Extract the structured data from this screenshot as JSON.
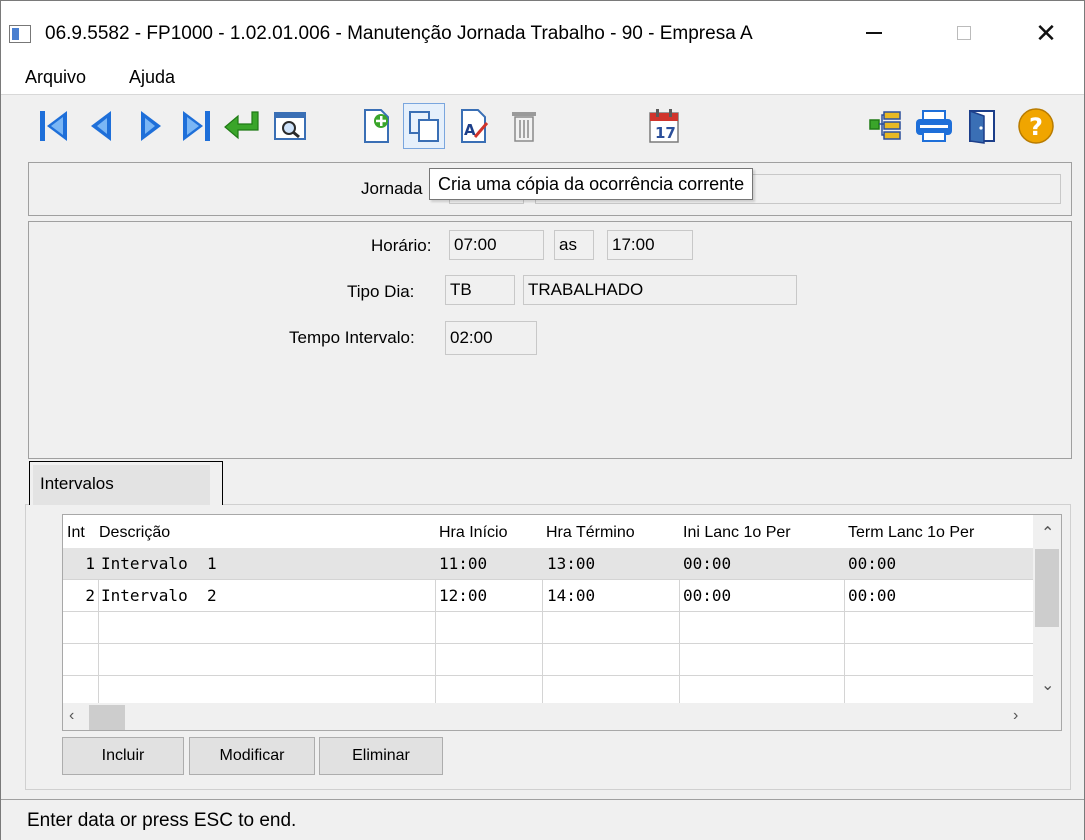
{
  "window": {
    "title": "06.9.5582 - FP1000 - 1.02.01.006 - Manutenção Jornada Trabalho - 90 - Empresa A"
  },
  "menu": {
    "items": [
      "Arquivo",
      "Ajuda"
    ]
  },
  "toolbar": {
    "icons": [
      "first-record-icon",
      "previous-record-icon",
      "next-record-icon",
      "last-record-icon",
      "confirm-enter-icon",
      "search-preview-icon",
      "new-record-icon",
      "copy-record-icon",
      "edit-record-icon",
      "delete-record-icon",
      "calendar-icon",
      "tree-structure-icon",
      "print-icon",
      "exit-door-icon",
      "help-icon"
    ],
    "calendar_day": "17",
    "tooltip": "Cria uma cópia da ocorrência corrente"
  },
  "header": {
    "jornada_label": "Jornada"
  },
  "form": {
    "horario_label": "Horário:",
    "horario_inicio": "07:00",
    "as_label": "as",
    "horario_fim": "17:00",
    "tipo_dia_label": "Tipo Dia:",
    "tipo_dia_codigo": "TB",
    "tipo_dia_descricao": "TRABALHADO",
    "tempo_intervalo_label": "Tempo Intervalo:",
    "tempo_intervalo": "02:00"
  },
  "tabs": {
    "intervalos": "Intervalos"
  },
  "grid": {
    "columns": [
      "Int",
      "Descrição",
      "Hra Início",
      "Hra Término",
      "Ini Lanc 1o Per",
      "Term Lanc 1o Per"
    ],
    "rows": [
      {
        "int": "1",
        "descricao": "Intervalo  1",
        "hra_inicio": "11:00",
        "hra_termino": "13:00",
        "ini_lanc": "00:00",
        "term_lanc": "00:00"
      },
      {
        "int": "2",
        "descricao": "Intervalo  2",
        "hra_inicio": "12:00",
        "hra_termino": "14:00",
        "ini_lanc": "00:00",
        "term_lanc": "00:00"
      }
    ]
  },
  "buttons": {
    "incluir": "Incluir",
    "modificar": "Modificar",
    "eliminar": "Eliminar"
  },
  "status": {
    "text": "Enter data or press ESC to end."
  },
  "colors": {
    "nav_blue": "#1e6fd9",
    "confirm_green": "#3aa52a",
    "help_orange": "#f0a500"
  }
}
